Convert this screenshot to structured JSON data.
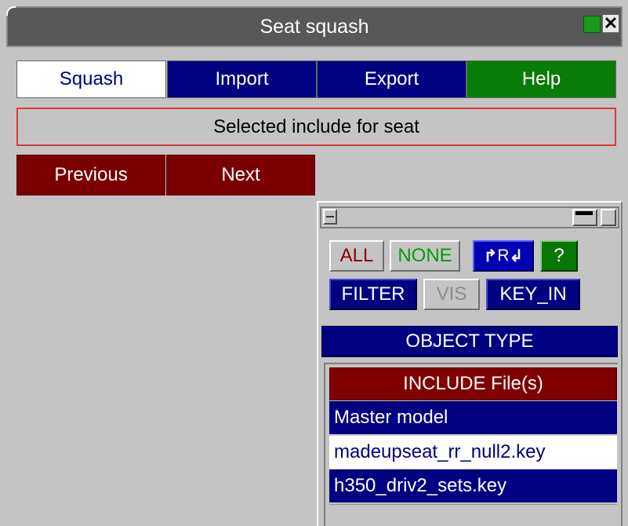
{
  "window": {
    "title": "Seat squash",
    "close_label": "✕"
  },
  "tabs": [
    {
      "label": "Squash",
      "active": true
    },
    {
      "label": "Import",
      "active": false
    },
    {
      "label": "Export",
      "active": false
    },
    {
      "label": "Help",
      "active": false
    }
  ],
  "include_label": "Selected include for seat",
  "nav": {
    "previous": "Previous",
    "next": "Next"
  },
  "selection_panel": {
    "all": "ALL",
    "none": "NONE",
    "reverse": "R",
    "help": "?",
    "filter": "FILTER",
    "vis": "VIS",
    "key_in": "KEY_IN",
    "object_type": "OBJECT TYPE",
    "list_header": "INCLUDE File(s)",
    "items": [
      {
        "label": "Master model",
        "selected": true
      },
      {
        "label": "madeupseat_rr_null2.key",
        "selected": false
      },
      {
        "label": "h350_driv2_sets.key",
        "selected": true
      }
    ]
  },
  "colors": {
    "tab_active_bg": "#ffffff",
    "tab_bg": "#000080",
    "help_bg": "#087c08",
    "nav_bg": "#7a0000",
    "panel_bg": "#c4c4c4",
    "header_bg": "#800000"
  }
}
